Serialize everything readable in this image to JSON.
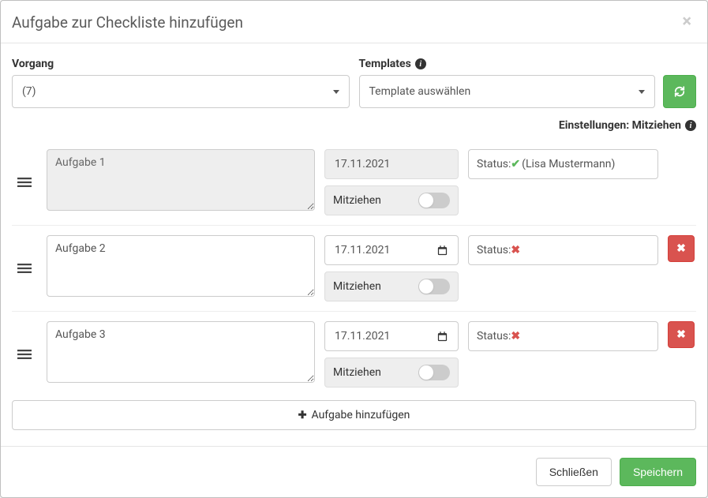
{
  "modal": {
    "title": "Aufgabe zur Checkliste hinzufügen",
    "close_label": "×"
  },
  "vorgang": {
    "label": "Vorgang",
    "selected": "(7)"
  },
  "templates": {
    "label": "Templates",
    "placeholder": "Template auswählen"
  },
  "settings": {
    "label": "Einstellungen: Mitziehen"
  },
  "common": {
    "mitziehen": "Mitziehen",
    "status_label": "Status:"
  },
  "tasks": [
    {
      "title": "Aufgabe 1",
      "date": "17.11.2021",
      "status_ok": true,
      "status_user": "(Lisa Mustermann)",
      "disabled": true,
      "deletable": false
    },
    {
      "title": "Aufgabe 2",
      "date": "17.11.2021",
      "status_ok": false,
      "status_user": "",
      "disabled": false,
      "deletable": true
    },
    {
      "title": "Aufgabe 3",
      "date": "17.11.2021",
      "status_ok": false,
      "status_user": "",
      "disabled": false,
      "deletable": true
    }
  ],
  "add_task": {
    "label": "Aufgabe hinzufügen"
  },
  "footer": {
    "close": "Schließen",
    "save": "Speichern"
  }
}
